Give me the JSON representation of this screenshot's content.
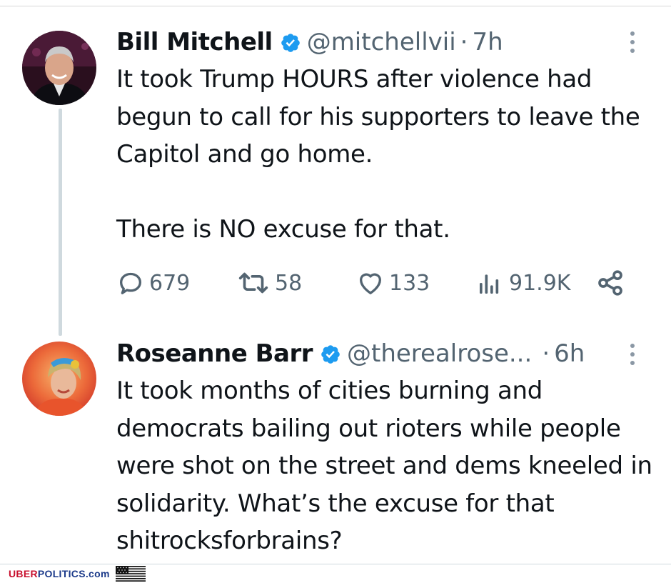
{
  "tweets": [
    {
      "name": "Bill Mitchell",
      "handle": "@mitchellvii",
      "separator": "·",
      "time": "7h",
      "text": "It took Trump HOURS after violence had begun to call for his supporters to leave the Capitol and go home.\n\nThere is NO excuse for that.",
      "stats": {
        "replies": "679",
        "retweets": "58",
        "likes": "133",
        "views": "91.9K"
      }
    },
    {
      "name": "Roseanne Barr",
      "handle": "@therealrose...",
      "separator": "·",
      "time": "6h",
      "text": "It took months of cities burning and democrats bailing out rioters while people were shot on the street and dems kneeled in solidarity. What’s the excuse for that shitrocksforbrains?"
    }
  ],
  "footer": {
    "brand_part1": "UBER",
    "brand_part2": "POLITICS",
    "brand_part3": ".com"
  },
  "colors": {
    "verified": "#1d9bf0",
    "secondary_text": "#536471",
    "thread_line": "#cfd9de",
    "brand_red": "#c8102e",
    "brand_blue": "#1b3a8a"
  },
  "icons": [
    "reply-icon",
    "retweet-icon",
    "like-icon",
    "views-icon",
    "share-icon",
    "verified-badge-icon",
    "more-options-icon",
    "us-flag-icon"
  ]
}
